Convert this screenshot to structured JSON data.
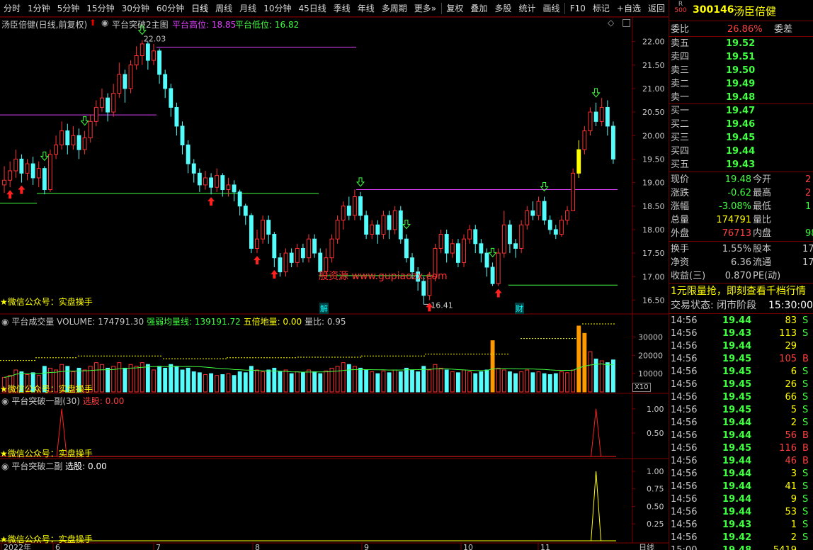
{
  "toolbar": {
    "items": [
      "分时",
      "1分钟",
      "5分钟",
      "15分钟",
      "30分钟",
      "60分钟",
      "日线",
      "周线",
      "月线",
      "10分钟",
      "45日线",
      "季线",
      "年线",
      "多周期",
      "更多»",
      "复权",
      "叠加",
      "多股",
      "统计",
      "画线",
      "F10",
      "标记",
      "+自选",
      "返回"
    ],
    "active": "日线"
  },
  "stock": {
    "code": "300146",
    "name": "汤臣倍健",
    "badge_top": "R",
    "badge_bottom": "500",
    "chart_caption": "汤臣倍健(日线,前复权)"
  },
  "main_pane": {
    "indicator_name": "平台突破2主图",
    "high_label": "平台高位: 18.85",
    "low_label": "平台低位: 16.82",
    "high_annot": "22.03",
    "low_annot": "16.41",
    "watermark": "股资源 www.gupiaozx.com",
    "mark_jie": "解",
    "mark_cai": "财",
    "promo": "★微信公众号：实盘操手",
    "y_ticks": [
      "22.00",
      "21.50",
      "21.00",
      "20.50",
      "20.00",
      "19.50",
      "19.00",
      "18.50",
      "18.00",
      "17.50",
      "17.00",
      "16.50"
    ]
  },
  "volume_pane": {
    "title": "平台成交量",
    "volume_label": "VOLUME: 174791.30",
    "avg_label": "强弱均量线: 139191.72",
    "five_label": "五倍地量: 0.00",
    "ratio_label": "量比: 0.95",
    "promo": "★微信公众号：实盘操手",
    "y_ticks": [
      "30000",
      "20000",
      "10000"
    ],
    "unit": "X10"
  },
  "sub1": {
    "title": "平台突破一副(30)",
    "select_label": "选股: 0.00",
    "promo": "★微信公众号：实盘操手",
    "y_ticks": [
      "1.00",
      "0.50"
    ]
  },
  "sub2": {
    "title": "平台突破二副",
    "select_label": "选股: 0.00",
    "promo": "★微信公众号：实盘操手",
    "y_ticks": [
      "1.00",
      "0.75",
      "0.50",
      "0.25"
    ]
  },
  "x_axis": {
    "labels": [
      "2022年",
      "6",
      "7",
      "8",
      "9",
      "10",
      "11"
    ],
    "period": "日线"
  },
  "chart_data": {
    "type": "candlestick",
    "y_range": [
      16.25,
      22.25
    ],
    "candles": [
      [
        18.95,
        19.05,
        19.35,
        18.78
      ],
      [
        19.05,
        19.25,
        19.45,
        18.9
      ],
      [
        19.25,
        19.5,
        19.7,
        19.1
      ],
      [
        19.5,
        19.2,
        19.6,
        19.0
      ],
      [
        19.2,
        19.4,
        19.5,
        19.05
      ],
      [
        19.4,
        19.1,
        19.55,
        18.95
      ],
      [
        19.1,
        19.3,
        19.45,
        18.9
      ],
      [
        19.3,
        18.85,
        19.35,
        18.75
      ],
      [
        18.85,
        19.6,
        19.7,
        18.8
      ],
      [
        19.6,
        19.8,
        20.0,
        19.5
      ],
      [
        19.8,
        20.1,
        20.3,
        19.7
      ],
      [
        20.1,
        19.8,
        20.25,
        19.6
      ],
      [
        19.8,
        20.0,
        20.2,
        19.7
      ],
      [
        20.0,
        19.7,
        20.15,
        19.5
      ],
      [
        19.7,
        19.95,
        20.1,
        19.6
      ],
      [
        19.95,
        20.3,
        20.45,
        19.85
      ],
      [
        20.3,
        20.6,
        20.75,
        20.2
      ],
      [
        20.6,
        20.8,
        21.0,
        20.5
      ],
      [
        20.8,
        20.5,
        20.9,
        20.3
      ],
      [
        20.5,
        20.9,
        21.1,
        20.4
      ],
      [
        20.9,
        21.3,
        21.55,
        20.8
      ],
      [
        21.3,
        21.0,
        21.4,
        20.7
      ],
      [
        21.0,
        21.5,
        21.6,
        20.9
      ],
      [
        21.5,
        21.7,
        21.9,
        21.4
      ],
      [
        21.7,
        21.95,
        22.03,
        21.5
      ],
      [
        21.95,
        21.6,
        22.0,
        21.4
      ],
      [
        21.6,
        21.8,
        21.95,
        21.5
      ],
      [
        21.8,
        21.3,
        21.85,
        21.1
      ],
      [
        21.3,
        21.0,
        21.4,
        20.8
      ],
      [
        21.0,
        20.6,
        21.1,
        20.4
      ],
      [
        20.6,
        20.2,
        20.7,
        20.0
      ],
      [
        20.2,
        19.8,
        20.3,
        19.6
      ],
      [
        19.8,
        19.4,
        19.9,
        19.2
      ],
      [
        19.4,
        19.2,
        19.5,
        19.0
      ],
      [
        19.2,
        18.95,
        19.3,
        18.8
      ],
      [
        18.95,
        19.1,
        19.25,
        18.85
      ],
      [
        19.1,
        18.9,
        19.2,
        18.75
      ],
      [
        18.9,
        19.15,
        19.3,
        18.8
      ],
      [
        19.15,
        18.85,
        19.2,
        18.7
      ],
      [
        18.85,
        18.95,
        19.1,
        18.7
      ],
      [
        18.95,
        18.8,
        19.05,
        18.6
      ],
      [
        18.8,
        18.5,
        18.85,
        18.3
      ],
      [
        18.5,
        18.3,
        18.55,
        18.1
      ],
      [
        18.3,
        17.6,
        18.35,
        17.5
      ],
      [
        17.6,
        17.8,
        18.0,
        17.5
      ],
      [
        17.8,
        18.2,
        18.3,
        17.7
      ],
      [
        18.2,
        17.9,
        18.3,
        17.7
      ],
      [
        17.9,
        17.4,
        17.95,
        17.2
      ],
      [
        17.4,
        17.1,
        17.5,
        17.0
      ],
      [
        17.1,
        17.5,
        17.6,
        17.0
      ],
      [
        17.5,
        17.3,
        17.6,
        17.2
      ],
      [
        17.3,
        17.6,
        17.7,
        17.2
      ],
      [
        17.6,
        17.4,
        17.7,
        17.3
      ],
      [
        17.4,
        17.8,
        17.9,
        17.3
      ],
      [
        17.8,
        17.5,
        17.9,
        17.4
      ],
      [
        17.5,
        17.1,
        17.6,
        17.0
      ],
      [
        17.1,
        17.4,
        17.6,
        17.0
      ],
      [
        17.4,
        17.8,
        17.9,
        17.3
      ],
      [
        17.8,
        18.2,
        18.3,
        17.7
      ],
      [
        18.2,
        18.5,
        18.6,
        18.0
      ],
      [
        18.5,
        18.3,
        18.7,
        18.2
      ],
      [
        18.3,
        18.7,
        18.85,
        18.2
      ],
      [
        18.7,
        18.3,
        18.8,
        18.2
      ],
      [
        18.3,
        17.9,
        18.4,
        17.8
      ],
      [
        17.9,
        18.1,
        18.2,
        17.8
      ],
      [
        18.1,
        17.9,
        18.2,
        17.7
      ],
      [
        17.9,
        18.3,
        18.4,
        17.8
      ],
      [
        18.3,
        18.0,
        18.4,
        17.8
      ],
      [
        18.0,
        18.4,
        18.5,
        17.9
      ],
      [
        18.4,
        17.8,
        18.5,
        17.7
      ],
      [
        17.8,
        17.4,
        17.9,
        17.3
      ],
      [
        17.4,
        17.1,
        17.5,
        16.95
      ],
      [
        17.1,
        16.9,
        17.2,
        16.7
      ],
      [
        16.9,
        16.6,
        17.0,
        16.41
      ],
      [
        16.6,
        17.0,
        17.1,
        16.5
      ],
      [
        17.0,
        17.6,
        17.7,
        16.9
      ],
      [
        17.6,
        17.9,
        18.0,
        17.5
      ],
      [
        17.9,
        17.5,
        18.0,
        17.3
      ],
      [
        17.5,
        17.7,
        17.8,
        17.4
      ],
      [
        17.7,
        17.3,
        17.8,
        17.2
      ],
      [
        17.3,
        17.8,
        17.9,
        17.2
      ],
      [
        17.8,
        18.0,
        18.1,
        17.7
      ],
      [
        18.0,
        17.7,
        18.1,
        17.5
      ],
      [
        17.7,
        17.5,
        17.8,
        17.3
      ],
      [
        17.5,
        17.2,
        17.6,
        17.0
      ],
      [
        17.2,
        16.85,
        17.3,
        16.8
      ],
      [
        16.85,
        17.5,
        17.6,
        16.8
      ],
      [
        17.5,
        18.1,
        18.4,
        17.4
      ],
      [
        18.1,
        17.7,
        18.2,
        17.5
      ],
      [
        17.7,
        17.6,
        17.8,
        17.4
      ],
      [
        17.6,
        18.1,
        18.2,
        17.5
      ],
      [
        18.1,
        18.4,
        18.5,
        18.0
      ],
      [
        18.4,
        18.3,
        18.6,
        18.2
      ],
      [
        18.3,
        18.6,
        18.7,
        18.2
      ],
      [
        18.6,
        18.2,
        18.7,
        18.1
      ],
      [
        18.2,
        18.0,
        18.3,
        17.9
      ],
      [
        18.0,
        17.9,
        18.1,
        17.8
      ],
      [
        17.9,
        18.2,
        18.3,
        17.85
      ],
      [
        18.2,
        18.4,
        18.5,
        18.1
      ],
      [
        18.4,
        19.2,
        19.3,
        18.4
      ],
      [
        19.2,
        19.7,
        19.9,
        19.1
      ],
      [
        19.7,
        20.1,
        20.2,
        19.6
      ],
      [
        20.1,
        20.5,
        20.6,
        20.0
      ],
      [
        20.5,
        20.3,
        20.7,
        20.2
      ],
      [
        20.3,
        20.6,
        20.8,
        20.2
      ],
      [
        20.6,
        20.2,
        20.75,
        20.0
      ],
      [
        20.2,
        19.5,
        20.3,
        19.4
      ]
    ],
    "volume_range": [
      0,
      36000
    ],
    "volumes": [
      8000,
      9000,
      12000,
      11000,
      9500,
      10500,
      9000,
      14000,
      13000,
      12000,
      15000,
      14000,
      11000,
      13000,
      12000,
      14000,
      16000,
      15000,
      13000,
      14000,
      16000,
      13000,
      15000,
      14000,
      16000,
      15000,
      12000,
      14000,
      13000,
      15000,
      14000,
      12000,
      13000,
      11000,
      10500,
      9500,
      10000,
      9000,
      9500,
      10000,
      9000,
      11000,
      10500,
      14000,
      12000,
      11000,
      12000,
      13000,
      11000,
      12000,
      10000,
      11000,
      10500,
      12000,
      11000,
      10000,
      11500,
      13000,
      14000,
      16000,
      15000,
      14000,
      13000,
      12000,
      11000,
      10000,
      11500,
      10500,
      12000,
      11000,
      13000,
      12000,
      11000,
      14000,
      12000,
      15000,
      13000,
      12000,
      11000,
      10500,
      12000,
      11000,
      10000,
      11000,
      12000,
      28000,
      13000,
      12000,
      11000,
      10000,
      11000,
      12000,
      10500,
      11000,
      10000,
      9500,
      10000,
      11000,
      10500,
      12000,
      36000,
      32000,
      22000,
      18000,
      17000,
      16000,
      17500
    ],
    "sub1_peaks": [
      {
        "index": 10,
        "value": 1.0
      },
      {
        "index": 103,
        "value": 1.0
      }
    ],
    "sub2_peaks": [
      {
        "index": 103,
        "value": 1.0
      }
    ]
  },
  "quote": {
    "wei_bi_label": "委比",
    "wei_bi": "26.86%",
    "wei_cha_label": "委差",
    "sells": [
      [
        "卖五",
        "19.52"
      ],
      [
        "卖四",
        "19.51"
      ],
      [
        "卖三",
        "19.50"
      ],
      [
        "卖二",
        "19.49"
      ],
      [
        "卖一",
        "19.48"
      ]
    ],
    "buys": [
      [
        "买一",
        "19.47"
      ],
      [
        "买二",
        "19.46"
      ],
      [
        "买三",
        "19.45"
      ],
      [
        "买四",
        "19.44"
      ],
      [
        "买五",
        "19.43"
      ]
    ],
    "stats": [
      [
        "现价",
        "19.48",
        "今开",
        "2"
      ],
      [
        "涨跌",
        "-0.62",
        "最高",
        "2"
      ],
      [
        "涨幅",
        "-3.08%",
        "最低",
        "1"
      ],
      [
        "总量",
        "174791",
        "量比",
        ""
      ],
      [
        "外盘",
        "76713",
        "内盘",
        "98"
      ]
    ],
    "stats2": [
      [
        "换手",
        "1.55%",
        "股本",
        "17"
      ],
      [
        "净资",
        "6.36",
        "流通",
        "17"
      ],
      [
        "收益(三)",
        "0.870",
        "PE(动)",
        ""
      ]
    ],
    "promo": "1元限量抢，即刻查看千档行情",
    "status_label": "交易状态: 闭市阶段",
    "status_time": "15:30:00",
    "ticks": [
      [
        "14:56",
        "19.44",
        "83",
        "S"
      ],
      [
        "14:56",
        "19.43",
        "113",
        "S"
      ],
      [
        "14:56",
        "19.44",
        "29",
        ""
      ],
      [
        "14:56",
        "19.45",
        "105",
        "B"
      ],
      [
        "14:56",
        "19.45",
        "6",
        "S"
      ],
      [
        "14:56",
        "19.45",
        "26",
        "S"
      ],
      [
        "14:56",
        "19.45",
        "66",
        "S"
      ],
      [
        "14:56",
        "19.45",
        "5",
        "S"
      ],
      [
        "14:56",
        "19.44",
        "2",
        "S"
      ],
      [
        "14:56",
        "19.44",
        "56",
        "B"
      ],
      [
        "14:56",
        "19.45",
        "116",
        "B"
      ],
      [
        "14:56",
        "19.44",
        "46",
        "B"
      ],
      [
        "14:56",
        "19.44",
        "3",
        "S"
      ],
      [
        "14:56",
        "19.44",
        "41",
        "S"
      ],
      [
        "14:56",
        "19.44",
        "9",
        "S"
      ],
      [
        "14:56",
        "19.44",
        "53",
        "S"
      ],
      [
        "14:56",
        "19.43",
        "1",
        "S"
      ],
      [
        "14:56",
        "19.42",
        "2",
        "S"
      ],
      [
        "15:00",
        "19.48",
        "5419",
        ""
      ]
    ]
  }
}
